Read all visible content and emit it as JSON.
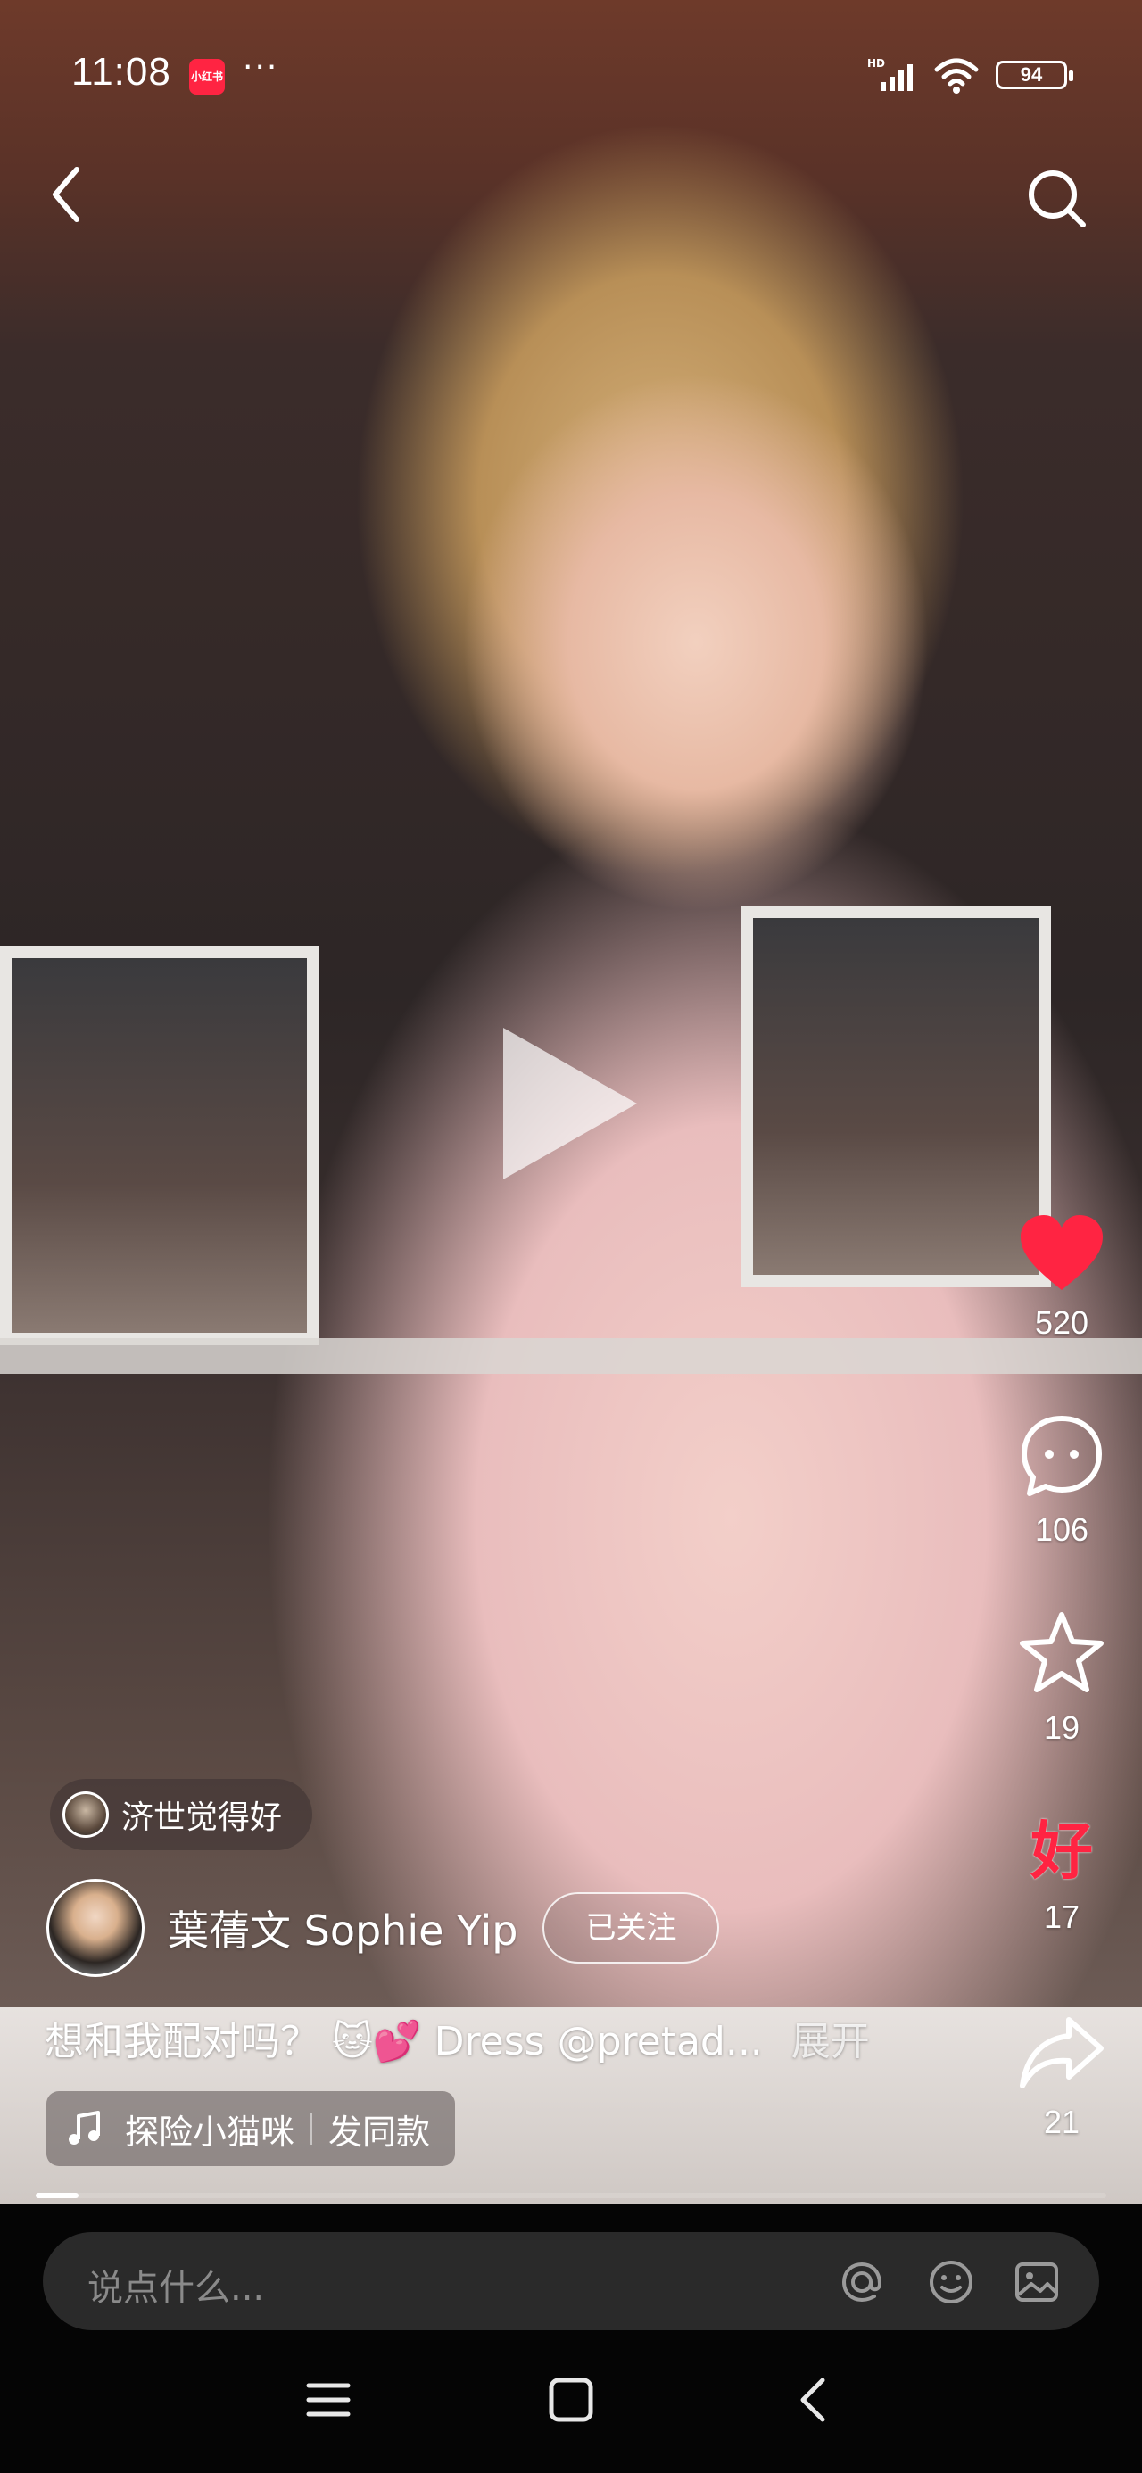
{
  "status_bar": {
    "time": "11:08",
    "app_badge": "小红书",
    "more": "···",
    "network": "HD",
    "battery": "94"
  },
  "icons": {
    "back": "back-arrow-icon",
    "search": "search-icon",
    "play": "play-icon",
    "like": "heart-icon",
    "comment": "comment-icon",
    "collect": "star-icon",
    "share": "share-icon",
    "music": "music-note-icon",
    "at": "at-icon",
    "emoji": "emoji-icon",
    "image": "image-icon"
  },
  "colors": {
    "like": "#ff2442",
    "good": "#ff2442"
  },
  "actions": {
    "like_count": "520",
    "comment_count": "106",
    "collect_count": "19",
    "good_label": "好",
    "good_count": "17",
    "share_count": "21"
  },
  "sticker": {
    "text": "济世觉得好"
  },
  "author": {
    "name": "葉蒨文 Sophie Yip",
    "follow_label": "已关注"
  },
  "caption": {
    "text": "想和我配对吗？",
    "emoji": "🐱💕",
    "rest": "Dress @pretad...",
    "expand": "展开"
  },
  "music": {
    "title": "探险小猫咪",
    "same_label": "发同款"
  },
  "video": {
    "progress": 0.04
  },
  "comment_bar": {
    "placeholder": "说点什么..."
  }
}
